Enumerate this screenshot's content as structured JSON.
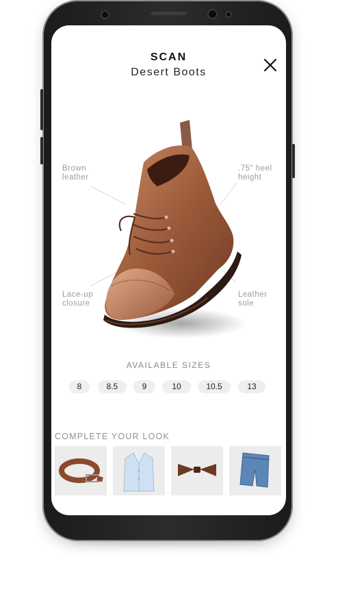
{
  "header": {
    "title": "SCAN",
    "subtitle": "Desert Boots"
  },
  "annotations": [
    {
      "id": "brown-leather",
      "text_l1": "Brown",
      "text_l2": "leather"
    },
    {
      "id": "heel-height",
      "text_l1": ".75\" heel",
      "text_l2": "height"
    },
    {
      "id": "lace-up",
      "text_l1": "Lace-up",
      "text_l2": "closure"
    },
    {
      "id": "leather-sole",
      "text_l1": "Leather",
      "text_l2": "sole"
    }
  ],
  "sizes": {
    "label": "AVAILABLE SIZES",
    "options": [
      "8",
      "8.5",
      "9",
      "10",
      "10.5",
      "13"
    ]
  },
  "look": {
    "label": "COMPLETE YOUR LOOK",
    "items": [
      "belt",
      "shirt",
      "bow-tie",
      "jeans"
    ]
  },
  "colors": {
    "leather": "#9a5a3a",
    "chip_bg": "#efefef",
    "text_muted": "#9b9b9b"
  },
  "icons": {
    "close": "close-icon"
  }
}
